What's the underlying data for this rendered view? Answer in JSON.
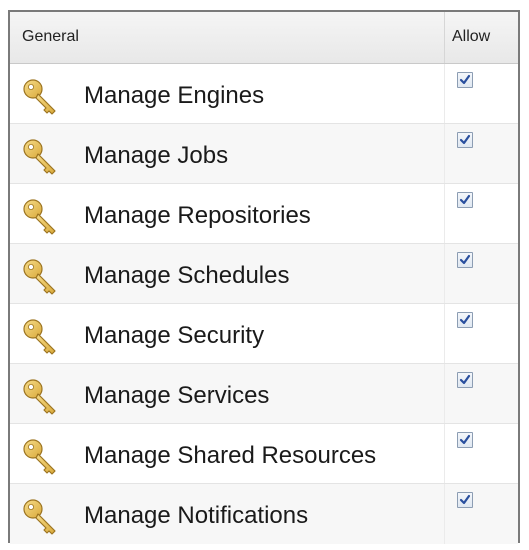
{
  "header": {
    "general_label": "General",
    "allow_label": "Allow"
  },
  "icon": "key-icon",
  "colors": {
    "key_gold": "#d9a93a",
    "check_blue": "#2a4f9e"
  },
  "rows": [
    {
      "label": "Manage Engines",
      "allowed": true
    },
    {
      "label": "Manage Jobs",
      "allowed": true
    },
    {
      "label": "Manage Repositories",
      "allowed": true
    },
    {
      "label": "Manage Schedules",
      "allowed": true
    },
    {
      "label": "Manage Security",
      "allowed": true
    },
    {
      "label": "Manage Services",
      "allowed": true
    },
    {
      "label": "Manage Shared Resources",
      "allowed": true
    },
    {
      "label": "Manage Notifications",
      "allowed": true
    }
  ]
}
